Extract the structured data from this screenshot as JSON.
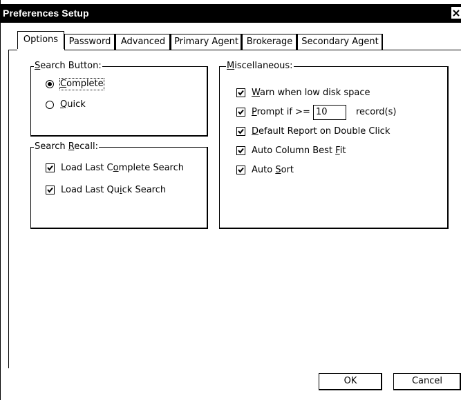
{
  "window": {
    "title": "Preferences Setup"
  },
  "tabs": [
    {
      "label": "Options",
      "active": true
    },
    {
      "label": "Password"
    },
    {
      "label": "Advanced"
    },
    {
      "label": "Primary Agent"
    },
    {
      "label": "Brokerage"
    },
    {
      "label": "Secondary Agent"
    }
  ],
  "search_button": {
    "legend_u": "S",
    "legend_rest": "earch Button:",
    "complete": {
      "u": "C",
      "rest": "omplete",
      "selected": true
    },
    "quick": {
      "u": "Q",
      "rest": "uick",
      "selected": false
    }
  },
  "search_recall": {
    "legend_pre": "Search ",
    "legend_u": "R",
    "legend_rest": "ecall:",
    "load_complete": {
      "pre": "Load Last C",
      "u": "o",
      "rest": "mplete Search",
      "checked": true
    },
    "load_quick": {
      "pre": "Load Last Qu",
      "u": "i",
      "rest": "ck Search",
      "checked": true
    }
  },
  "misc": {
    "legend_u": "M",
    "legend_rest": "iscellaneous:",
    "warn_low_disk": {
      "u": "W",
      "rest": "arn when low disk space",
      "checked": true
    },
    "prompt_if": {
      "u": "P",
      "rest": "rompt if >=",
      "checked": true,
      "value": "10",
      "suffix": "record(s)"
    },
    "default_report": {
      "u": "D",
      "rest": "efault Report on Double Click",
      "checked": true
    },
    "auto_column": {
      "pre": "Auto Column Best ",
      "u": "F",
      "rest": "it",
      "checked": true
    },
    "auto_sort": {
      "pre": "Auto ",
      "u": "S",
      "rest": "ort",
      "checked": true
    }
  },
  "buttons": {
    "ok": "OK",
    "cancel": "Cancel"
  },
  "icons": {
    "close": "close-icon",
    "check": "check-icon",
    "radio": "radio-dot-icon"
  }
}
